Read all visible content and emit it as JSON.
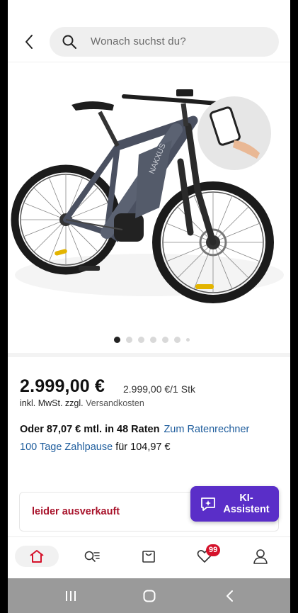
{
  "header": {
    "back_icon": "chevron-left-icon",
    "search_icon": "search-icon",
    "search_placeholder": "Wonach suchst du?"
  },
  "gallery": {
    "dots_total": 7,
    "active_index": 0
  },
  "product": {
    "price": "2.999,00 €",
    "unit_price": "2.999,00 €/1 Stk",
    "tax_prefix": "inkl. MwSt. zzgl.",
    "tax_link": "Versandkosten",
    "installment_text": "Oder 87,07 € mtl. in 48 Raten",
    "installment_link": "Zum Ratenrechner",
    "pause_link": "100 Tage Zahlpause",
    "pause_suffix": "für 104,97 €"
  },
  "stock": {
    "label": "leider ausverkauft"
  },
  "assistant": {
    "label": "KI-Assistent",
    "icon": "sparkle-chat-icon"
  },
  "bottom_nav": {
    "items": [
      {
        "name": "home",
        "icon": "home-icon"
      },
      {
        "name": "categories",
        "icon": "search-list-icon"
      },
      {
        "name": "cart",
        "icon": "shopping-bag-icon"
      },
      {
        "name": "wishlist",
        "icon": "heart-icon"
      },
      {
        "name": "account",
        "icon": "user-icon"
      }
    ],
    "wishlist_badge": "99"
  },
  "colors": {
    "brand_red": "#d5122b",
    "link_blue": "#1d5c9c",
    "assistant_purple": "#5a2ec8",
    "soldout_red": "#a8122a"
  }
}
